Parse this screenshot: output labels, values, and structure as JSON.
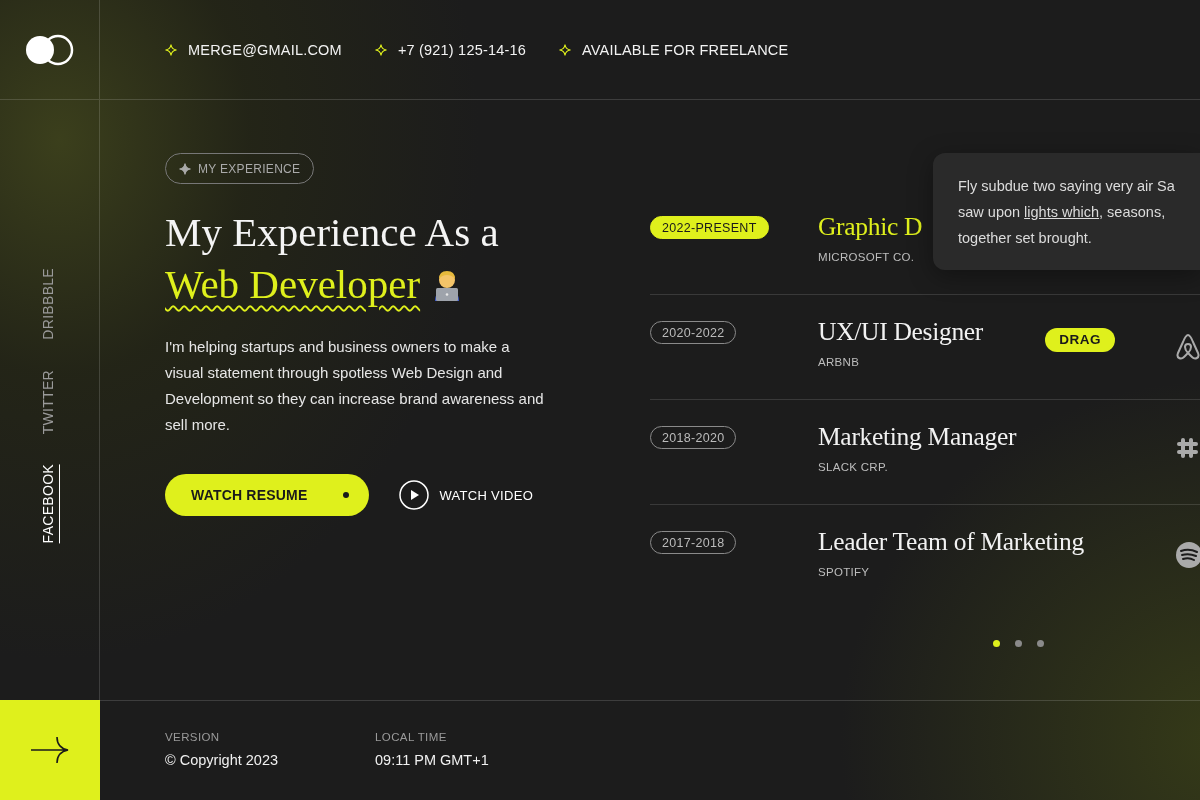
{
  "contacts": [
    {
      "text": "MERGE@GMAIL.COM"
    },
    {
      "text": "+7 (921) 125-14-16"
    },
    {
      "text": "AVAILABLE FOR FREELANCE"
    }
  ],
  "social_links": [
    {
      "label": "DRIBBBLE",
      "selected": false
    },
    {
      "label": "TWITTER",
      "selected": false
    },
    {
      "label": "FACEBOOK",
      "selected": true
    }
  ],
  "hero": {
    "tag": "MY EXPERIENCE",
    "title_line": "My Experience As a",
    "title_highlight": "Web Developer",
    "text": "I'm helping startups and business owners to make a visual statement through spotless Web Design and Development so they can increase brand awareness and sell more.",
    "buttons": [
      {
        "label": "WATCH RESUME",
        "kind": "primary"
      },
      {
        "label": "WATCH VIDEO",
        "kind": "play"
      }
    ]
  },
  "experience": {
    "items": [
      {
        "period": "2022-PRESENT",
        "title": "Graphic D",
        "company": "MICROSOFT CO.",
        "selected": true
      },
      {
        "period": "2020-2022",
        "title": "UX/UI Designer",
        "company": "ARBNB",
        "selected": false
      },
      {
        "period": "2018-2020",
        "title": "Marketing Manager",
        "company": "SLACK CRP.",
        "selected": false
      },
      {
        "period": "2017-2018",
        "title": "Leader Team of Marketing",
        "company": "SPOTIFY",
        "selected": false
      }
    ],
    "drag_badge": "DRAG",
    "tooltip": {
      "lines": [
        [
          {
            "kind": "text",
            "text": "Fly subdue two saying very air Sa"
          }
        ],
        [
          {
            "kind": "text",
            "text": "saw upon "
          },
          {
            "kind": "link",
            "text": "lights which"
          },
          {
            "kind": "text",
            "text": ", seasons,"
          }
        ],
        [
          {
            "kind": "text",
            "text": "together set brought."
          }
        ]
      ]
    },
    "pager": [
      {
        "selected": true
      },
      {
        "selected": false
      },
      {
        "selected": false
      }
    ]
  },
  "footer": {
    "version_label": "VERSION",
    "version": "© Copyright 2023",
    "time_label": "LOCAL TIME",
    "time": "09:11 PM GMT+1"
  }
}
